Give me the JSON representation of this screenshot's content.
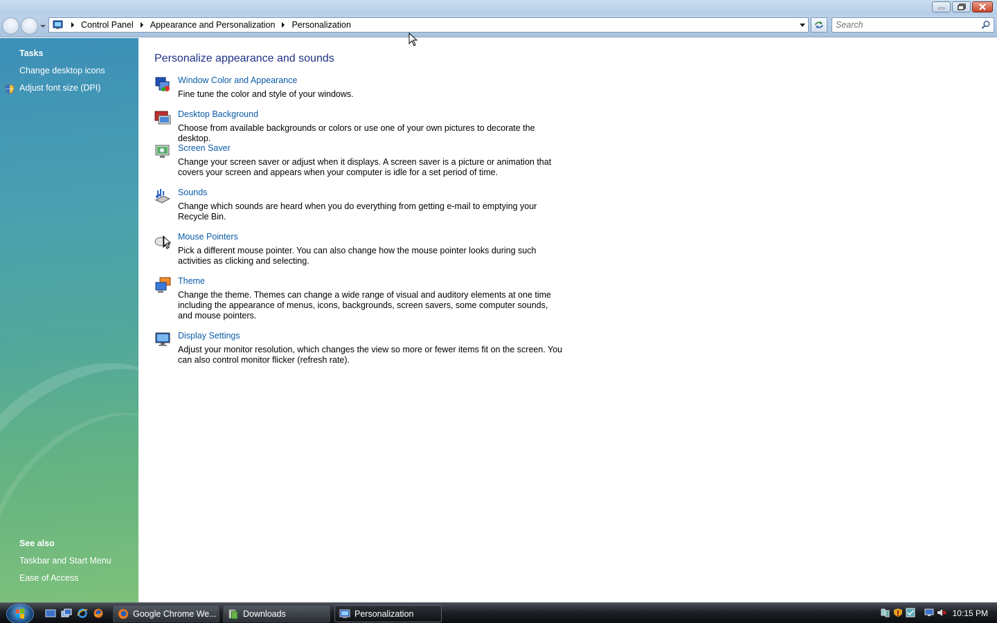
{
  "window": {
    "breadcrumb": [
      "Control Panel",
      "Appearance and Personalization",
      "Personalization"
    ],
    "search_placeholder": "Search"
  },
  "sidebar": {
    "tasks_heading": "Tasks",
    "tasks": [
      {
        "label": "Change desktop icons"
      },
      {
        "label": "Adjust font size (DPI)",
        "icon": "shield-icon"
      }
    ],
    "see_also_heading": "See also",
    "see_also": [
      {
        "label": "Taskbar and Start Menu"
      },
      {
        "label": "Ease of Access"
      }
    ]
  },
  "main": {
    "title": "Personalize appearance and sounds",
    "items": [
      {
        "label": "Window Color and Appearance",
        "desc": "Fine tune the color and style of your windows.",
        "icon": "window-color-icon"
      },
      {
        "label": "Desktop Background",
        "desc": "Choose from available backgrounds or colors or use one of your own pictures to decorate the desktop.",
        "icon": "desktop-background-icon"
      },
      {
        "label": "Screen Saver",
        "desc": "Change your screen saver or adjust when it displays. A screen saver is a picture or animation that covers your screen and appears when your computer is idle for a set period of time.",
        "icon": "screen-saver-icon"
      },
      {
        "label": "Sounds",
        "desc": "Change which sounds are heard when you do everything from getting e-mail to emptying your Recycle Bin.",
        "icon": "sounds-icon"
      },
      {
        "label": "Mouse Pointers",
        "desc": "Pick a different mouse pointer. You can also change how the mouse pointer looks during such activities as clicking and selecting.",
        "icon": "mouse-pointers-icon"
      },
      {
        "label": "Theme",
        "desc": "Change the theme. Themes can change a wide range of visual and auditory elements at one time including the appearance of menus, icons, backgrounds, screen savers, some computer sounds, and mouse pointers.",
        "icon": "theme-icon"
      },
      {
        "label": "Display Settings",
        "desc": "Adjust your monitor resolution, which changes the view so more or fewer items fit on the screen. You can also control monitor flicker (refresh rate).",
        "icon": "display-settings-icon"
      }
    ]
  },
  "taskbar": {
    "buttons": [
      {
        "label": "Google Chrome We...",
        "icon": "chrome-icon"
      },
      {
        "label": "Downloads",
        "icon": "folder-icon"
      },
      {
        "label": "Personalization",
        "icon": "personalization-icon",
        "active": true
      }
    ],
    "clock": "10:15 PM"
  }
}
